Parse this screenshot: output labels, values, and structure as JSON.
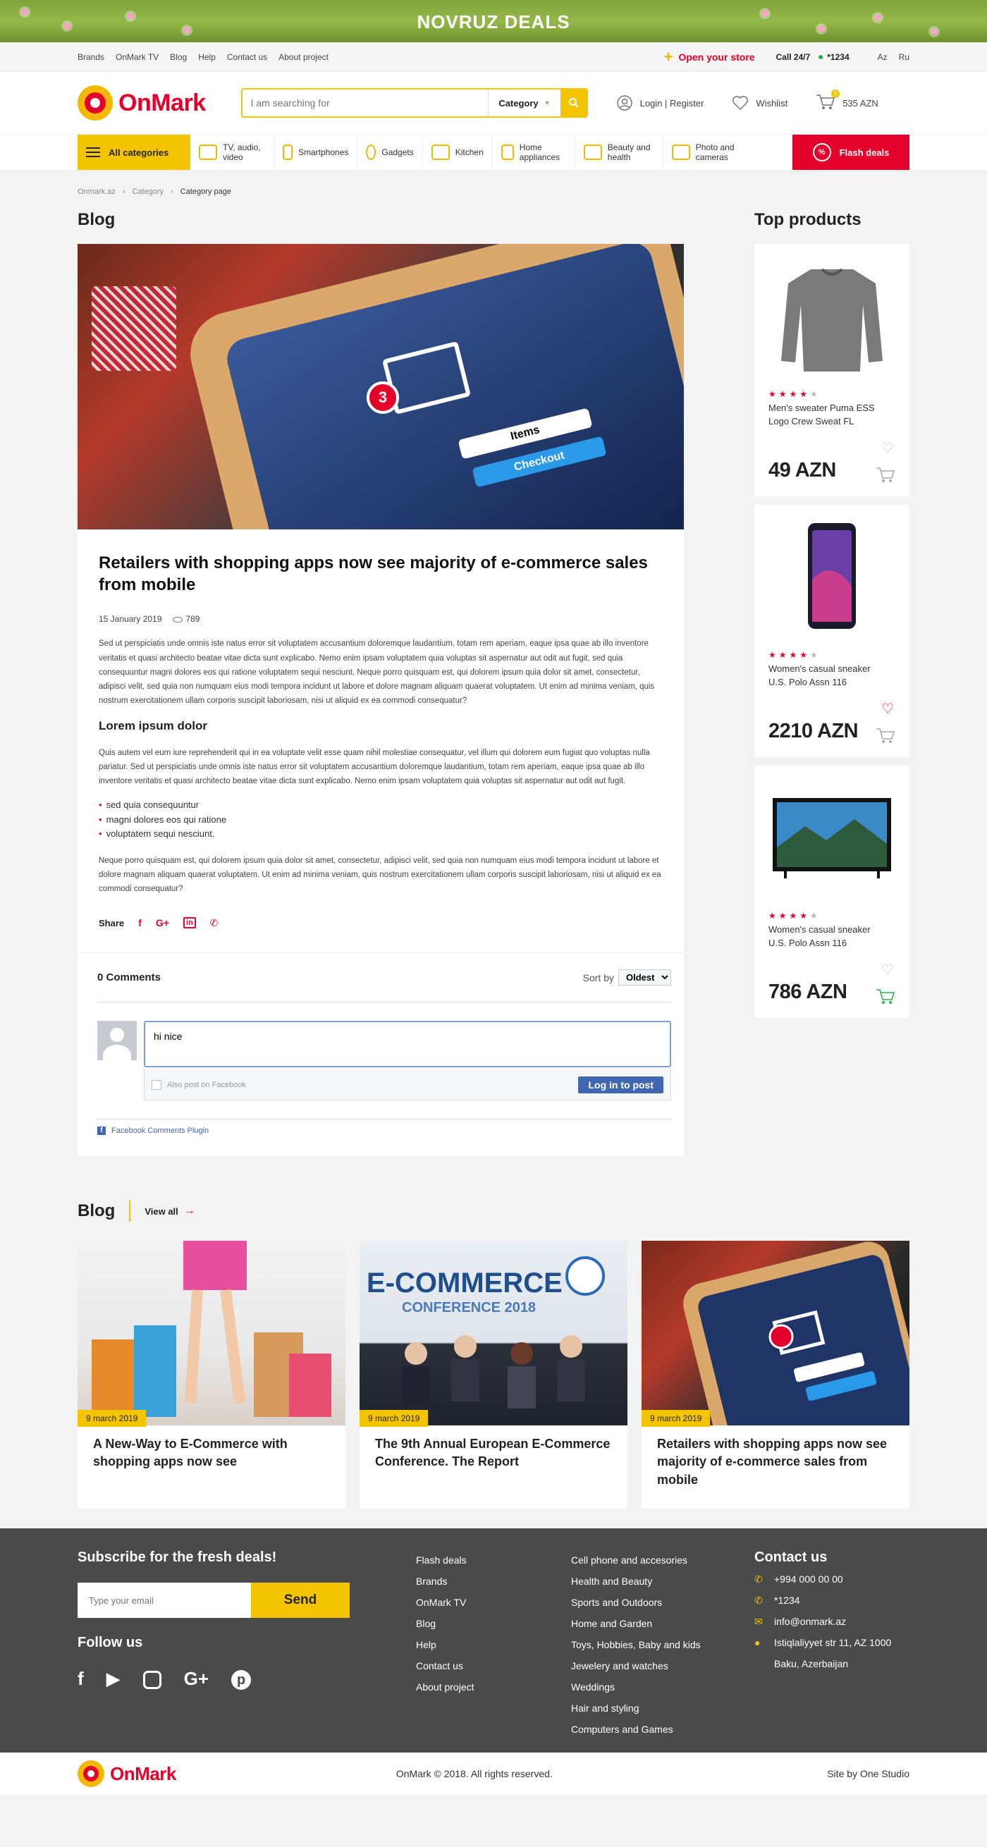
{
  "promo": {
    "title": "NOVRUZ DEALS"
  },
  "topbar": {
    "links": [
      "Brands",
      "OnMark TV",
      "Blog",
      "Help",
      "Contact us",
      "About project"
    ],
    "open_store": "Open your store",
    "call_label": "Call 24/7",
    "phone": "*1234",
    "langs": [
      "Az",
      "Ru"
    ]
  },
  "header": {
    "logo": "OnMark",
    "search_placeholder": "I am searching for",
    "category_label": "Category",
    "login": "Login | Register",
    "wishlist": "Wishlist",
    "cart_count": "0",
    "cart_total": "535 AZN"
  },
  "catbar": {
    "all": "All categories",
    "items": [
      "TV, audio, video",
      "Smartphones",
      "Gadgets",
      "Kitchen",
      "Home appliances",
      "Beauty and health",
      "Photo and cameras"
    ],
    "flash": "Flash deals"
  },
  "breadcrumb": [
    "Onmark.az",
    "Category",
    "Category page"
  ],
  "blog_heading": "Blog",
  "top_products_heading": "Top products",
  "article": {
    "hero_badge": "3",
    "hero_items": "Items",
    "hero_checkout": "Checkout",
    "title": "Retailers with shopping apps now see majority of e-commerce sales from mobile",
    "date": "15 January 2019",
    "views": "789",
    "p1": "Sed ut perspiciatis unde omnis iste natus error sit voluptatem accusantium doloremque laudantium, totam rem aperiam, eaque ipsa quae ab illo inventore veritatis et quasi architecto beatae vitae dicta sunt explicabo. Nemo enim ipsam voluptatem quia voluptas sit aspernatur aut odit aut fugit, sed quia consequuntur magni dolores eos qui ratione voluptatem sequi nesciunt. Neque porro quisquam est, qui dolorem ipsum quia dolor sit amet, consectetur, adipisci velit, sed quia non numquam eius modi tempora incidunt ut labore et dolore magnam aliquam quaerat voluptatem. Ut enim ad minima veniam, quis nostrum exercitationem ullam corporis suscipit laboriosam, nisi ut aliquid ex ea commodi consequatur?",
    "subtitle": "Lorem ipsum dolor",
    "p2": "Quis autem vel eum iure reprehenderit qui in ea voluptate velit esse quam nihil molestiae consequatur, vel illum qui dolorem eum fugiat quo voluptas nulla pariatur. Sed ut perspiciatis unde omnis iste natus error sit voluptatem accusantium doloremque laudantium, totam rem aperiam, eaque ipsa quae ab illo inventore veritatis et quasi architecto beatae vitae dicta sunt explicabo. Nemo enim ipsam voluptatem quia voluptas sit aspernatur aut odit aut fugit.",
    "bullets": [
      "sed quia consequuntur",
      "magni dolores eos qui ratione",
      "voluptatem sequi nesciunt."
    ],
    "p3": "Neque porro quisquam est, qui dolorem ipsum quia dolor sit amet, consectetur, adipisci velit, sed quia non numquam eius modi tempora incidunt ut labore et dolore magnam aliquam quaerat voluptatem. Ut enim ad minima veniam, quis nostrum exercitationem ullam corporis suscipit laboriosam, nisi ut aliquid ex ea commodi consequatur?",
    "share_label": "Share"
  },
  "comments": {
    "count": "0 Comments",
    "sort_label": "Sort by",
    "sort_value": "Oldest",
    "input_value": "hi nice",
    "also_post": "Also post on Facebook",
    "post_button": "Log in to post",
    "plugin": "Facebook Comments Plugin"
  },
  "products": [
    {
      "name": "Men's sweater Puma ESS Logo Crew Sweat FL",
      "price": "49 AZN",
      "rating": 4,
      "wish": false
    },
    {
      "name": "Women's casual sneaker U.S. Polo Assn 116",
      "price": "2210 AZN",
      "rating": 4,
      "wish": true
    },
    {
      "name": "Women's casual sneaker U.S. Polo Assn 116",
      "price": "786 AZN",
      "rating": 4,
      "wish": false
    }
  ],
  "blog_row": {
    "heading": "Blog",
    "view_all": "View all",
    "cards": [
      {
        "date": "9 march 2019",
        "title": "A New-Way to E-Commerce with shopping apps now see"
      },
      {
        "date": "9 march 2019",
        "title": "The 9th Annual European E-Commerce Conference. The Report",
        "img_text1": "E-COMMERCE",
        "img_text2": "CONFERENCE 2018"
      },
      {
        "date": "9 march 2019",
        "title": "Retailers with shopping apps now see majority of e-commerce sales from mobile"
      }
    ]
  },
  "footer": {
    "subscribe": "Subscribe for the fresh deals!",
    "email_placeholder": "Type your email",
    "send": "Send",
    "follow": "Follow us",
    "col1": [
      "Flash deals",
      "Brands",
      "OnMark TV",
      "Blog",
      "Help",
      "Contact us",
      "About project"
    ],
    "col2": [
      "Cell phone and accesories",
      "Health and Beauty",
      "Sports and Outdoors",
      "Home and Garden",
      "Toys, Hobbies, Baby and kids",
      "Jewelery and watches",
      "Weddings",
      "Hair and styling",
      "Computers and Games"
    ],
    "contact_title": "Contact us",
    "contacts": [
      "+994 000 00 00",
      "*1234",
      "info@onmark.az",
      "Istiqlaliyyet str 11, AZ 1000",
      "Baku, Azerbaijan"
    ],
    "copyright": "OnMark © 2018. All rights reserved.",
    "site_by": "Site by One Studio"
  },
  "colors": {
    "brand_red": "#e4002b",
    "brand_yellow": "#f5c400",
    "footer_bg": "#4a4a4a"
  }
}
